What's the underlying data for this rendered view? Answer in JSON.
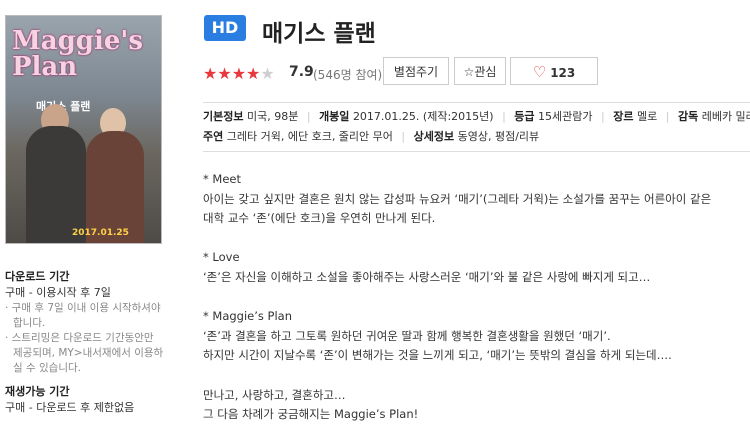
{
  "poster": {
    "title_en": "Maggie's Plan",
    "title_ko": "매기스 플랜",
    "date": "2017.01.25"
  },
  "header": {
    "badge": "HD",
    "title": "매기스 플랜"
  },
  "rating": {
    "stars": 4,
    "max_stars": 5,
    "score": "7.9",
    "participants": "(546명 참여)"
  },
  "actions": {
    "rate_label": "별점주기",
    "interest_label": "관심",
    "like_count": "123"
  },
  "info": {
    "basic_label": "기본정보",
    "basic_value": "미국, 98분",
    "release_label": "개봉일",
    "release_value": "2017.01.25. (제작:2015년)",
    "grade_label": "등급",
    "grade_value": "15세관람가",
    "genre_label": "장르",
    "genre_value": "멜로",
    "director_label": "감독",
    "director_value": "레베카 밀러",
    "cast_label": "주연",
    "cast_value": "그레타 거윅, 에단 호크, 줄리안 무어",
    "detail_label": "상세정보",
    "detail_value": "동영상, 평점/리뷰"
  },
  "synopsis": [
    "* Meet",
    "아이는 갖고 싶지만 결혼은 원치 않는 갑성파 뉴요커 ‘매기’(그레타 거윅)는 소설가를 꿈꾸는 어른아이 같은",
    "대학 교수 ‘존’(에단 호크)을 우연히 만나게 된다.",
    "",
    "* Love",
    "‘존’은 자신을 이해하고 소설을 좋아해주는 사랑스러운 ‘매기’와 불 같은 사랑에 빠지게 되고…",
    "",
    "* Maggie’s Plan",
    "‘존’과 결혼을 하고 그토록 원하던 귀여운 딸과 함께 행복한 결혼생활을 원했던 ‘매기’.",
    "하지만 시간이 지날수록 ‘존’이 변해가는 것을 느끼게 되고, ‘매기’는 뜻밖의 결심을 하게 되는데….",
    "",
    "만나고, 사랑하고, 결혼하고…",
    "그 다음 차례가 궁금해지는 Maggie’s Plan!"
  ],
  "download": {
    "title": "다운로드 기간",
    "line": "구매 - 이용시작 후 7일",
    "notes": [
      "· 구매 후 7일 이내 이용 시작하셔야 합니다.",
      "· 스트리밍은 다운로드 기간동안만 제공되며, MY>내서재에서 이용하실 수 있습니다."
    ]
  },
  "playback": {
    "title": "재생가능 기간",
    "line": "구매 - 다운로드 후 제한없음"
  }
}
